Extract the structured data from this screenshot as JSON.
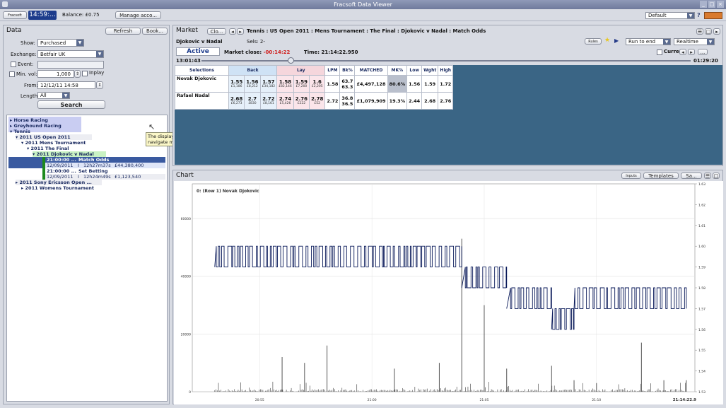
{
  "window": {
    "title": "Fracsoft Data Viewer",
    "controls": [
      "_",
      "□",
      "×"
    ]
  },
  "toolbar": {
    "logo_label": "Fracsoft",
    "clock": "14:59:...",
    "balance": "Balance: £0.75",
    "manage_label": "Manage acco...",
    "profile_value": "Default"
  },
  "data_panel": {
    "title": "Data",
    "refresh_label": "Refresh",
    "book_label": "Book...",
    "show_label": "Show:",
    "show_value": "Purchased",
    "exchange_label": "Exchange:",
    "exchange_value": "Betfair UK",
    "event_label": "Event:",
    "min_vol_label": "Min. vol:",
    "min_vol_value": "1,000",
    "inplay_label": "Inplay",
    "from_label": "From:",
    "from_value": "12/12/11 14:58",
    "length_label": "Length:",
    "length_value": "All",
    "search_label": "Search",
    "tree": {
      "horse": "Horse Racing",
      "grey": "Greyhound Racing",
      "tennis": "Tennis",
      "usopen": "2011 US Open 2011",
      "mens": "2011 Mens Tournament",
      "final": "2011 The Final",
      "match": "2011 Djokovic v Nadal",
      "m1_time": "21:00:00 ...",
      "m1_name": "Match Odds",
      "m1_date": "12/09/2011",
      "m1_sep": "I",
      "m1_dur": "12h27m37s",
      "m1_amt": "£44,380,400",
      "m2_time": "21:00:00 ...",
      "m2_name": "Set Betting",
      "m2_date": "12/09/2011",
      "m2_sep": "I",
      "m2_dur": "12h24m49s",
      "m2_amt": "£1,123,540",
      "sony": "2011 Sony Ericsson Open ...",
      "womens": "2011 Womens Tournament"
    },
    "tooltip_l1": "The display allows you to:",
    "tooltip_l2": "navigate markets, purchase them, and open them"
  },
  "market_panel": {
    "title": "Market",
    "close_label": "Clo...",
    "path": "Tennis : US Open 2011 : Mens Tournament : The Final : Djokovic v Nadal : Match Odds",
    "event_name": "Djokovic v Nadal",
    "sels": "Sels: 2-",
    "rules_label": "Rules",
    "run_value": "Run to end",
    "realtime_value": "Realtime",
    "status": "Active",
    "market_close_label": "Market close:",
    "market_close_value": "-00:14:22",
    "time_label": "Time: 21:14:22.950",
    "current_label": "Current",
    "elapsed": "13:01:43",
    "remaining": "01:29:20",
    "headers": [
      "Selections",
      "Back",
      "Lay",
      "LPM",
      "Bk%",
      "MATCHED",
      "MK%",
      "Low",
      "Wght",
      "High"
    ],
    "rows": [
      {
        "name": "Novak Djokovic",
        "back": [
          [
            "1.55",
            "£1,186"
          ],
          [
            "1.56",
            "£8,212"
          ],
          [
            "1.57",
            "£34,182"
          ]
        ],
        "lay": [
          [
            "1.58",
            "£82,146"
          ],
          [
            "1.59",
            "£7,200"
          ],
          [
            "1.6",
            "£2,205"
          ]
        ],
        "lpm": "1.58",
        "bk1": "63.7",
        "bk2": "63.3",
        "matched": "£4,497,128",
        "mk": "80.6%",
        "low": "1.56",
        "wght": "1.59",
        "high": "1.72"
      },
      {
        "name": "Rafael Nadal",
        "back": [
          [
            "2.68",
            "£6,273"
          ],
          [
            "2.7",
            "£830"
          ],
          [
            "2.72",
            "£8,161"
          ]
        ],
        "lay": [
          [
            "2.74",
            "£5,426"
          ],
          [
            "2.76",
            "£222"
          ],
          [
            "2.78",
            "£52"
          ]
        ],
        "lpm": "2.72",
        "bk1": "36.8",
        "bk2": "36.5",
        "matched": "£1,079,909",
        "mk": "19.3%",
        "low": "2.44",
        "wght": "2.68",
        "high": "2.76"
      }
    ]
  },
  "chart_panel": {
    "title": "Chart",
    "inputs_label": "Inputs",
    "templates_label": "Templates",
    "save_label": "Sa...",
    "chart_title": "0: (Row 1) Novak Djokovic"
  },
  "chart_data": {
    "type": "line",
    "title": "0: (Row 1) Novak Djokovic",
    "x_ticks": [
      "20:55",
      "21:00",
      "21:05",
      "21:10",
      "21:14:22.9"
    ],
    "y_left_ticks": [
      "60000",
      "40000",
      "20000",
      "0"
    ],
    "y_left_range": [
      0,
      72000
    ],
    "y_right_ticks": [
      "1.63",
      "1.62",
      "1.61",
      "1.60",
      "1.59",
      "1.58",
      "1.57",
      "1.56",
      "1.55",
      "1.54",
      "1.53"
    ],
    "y_right_range": [
      1.53,
      1.63
    ],
    "series": [
      {
        "kind": "price-line",
        "segments": [
          {
            "from": "20:53",
            "to": "21:04",
            "low": 1.59,
            "high": 1.6
          },
          {
            "from": "21:04",
            "to": "21:06",
            "low": 1.58,
            "high": 1.59
          },
          {
            "from": "21:06",
            "to": "21:08",
            "low": 1.57,
            "high": 1.58
          },
          {
            "from": "21:08",
            "to": "21:09",
            "low": 1.56,
            "high": 1.57
          },
          {
            "from": "21:09",
            "to": "21:14",
            "low": 1.57,
            "high": 1.58
          }
        ]
      },
      {
        "kind": "volume-bars",
        "spikes": [
          {
            "t": "20:56",
            "v": 12000
          },
          {
            "t": "20:57",
            "v": 10000
          },
          {
            "t": "20:58",
            "v": 16000
          },
          {
            "t": "21:01",
            "v": 8000
          },
          {
            "t": "21:03",
            "v": 10000
          },
          {
            "t": "21:04",
            "v": 53000
          },
          {
            "t": "21:05",
            "v": 30000
          },
          {
            "t": "21:06",
            "v": 8000
          },
          {
            "t": "21:08",
            "v": 9000
          },
          {
            "t": "21:09",
            "v": 4000
          },
          {
            "t": "21:10",
            "v": 3000
          },
          {
            "t": "21:12",
            "v": 17000
          },
          {
            "t": "21:13",
            "v": 4000
          },
          {
            "t": "21:14",
            "v": 4000
          }
        ]
      }
    ],
    "grid": true
  }
}
